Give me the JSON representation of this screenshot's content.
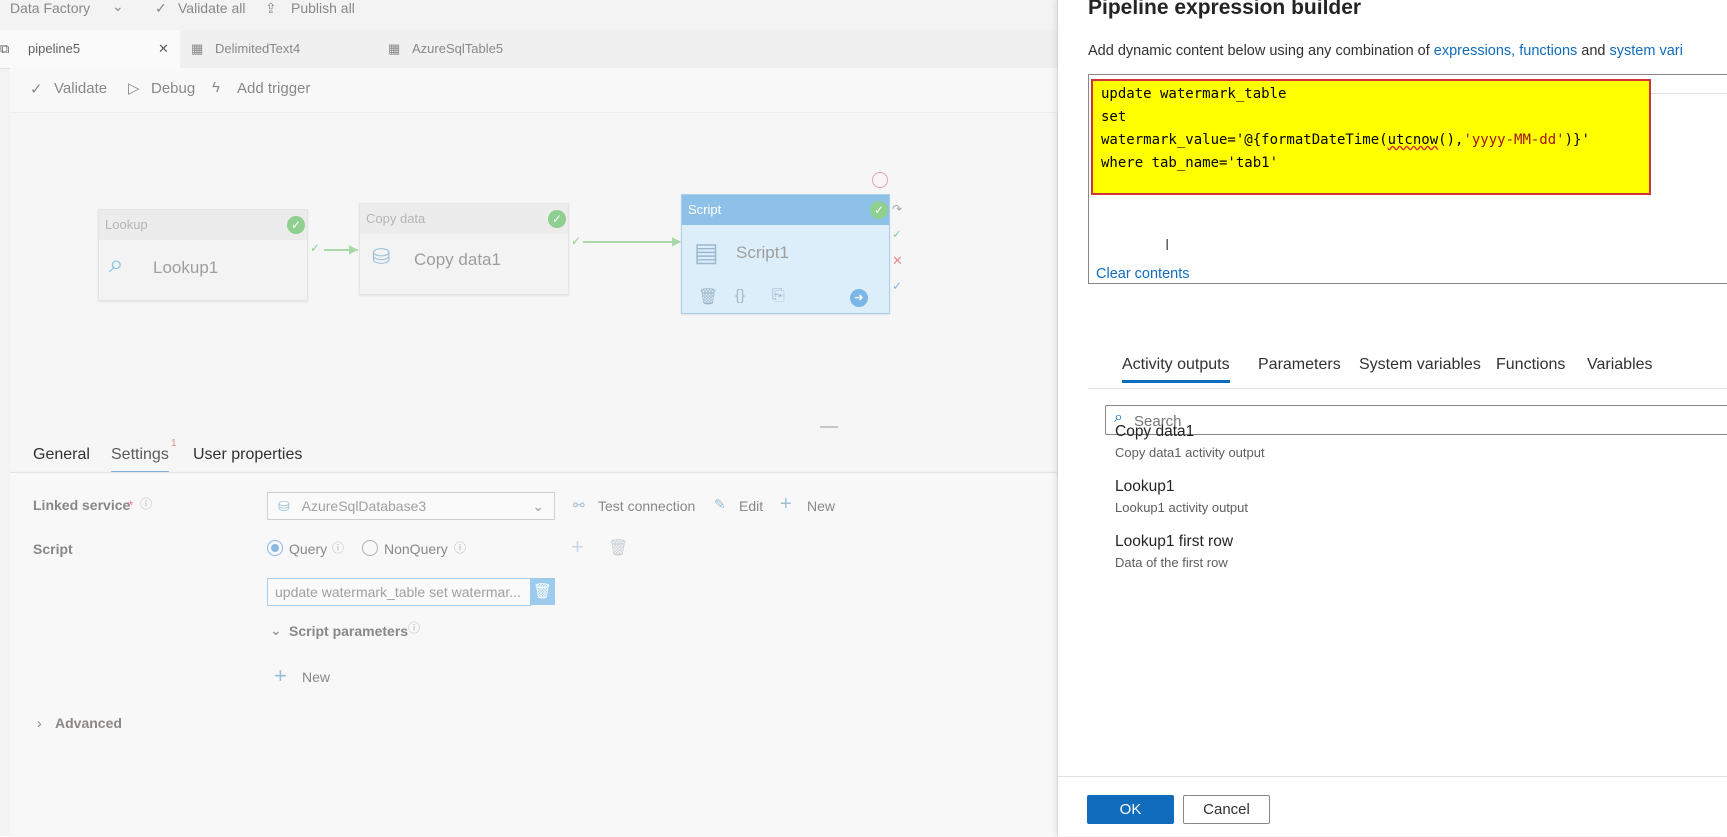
{
  "topbar": {
    "app": "Data Factory",
    "validate_all": "Validate all",
    "publish_all": "Publish all"
  },
  "tabs": [
    {
      "label": "pipeline5",
      "active": true
    },
    {
      "label": "DelimitedText4",
      "active": false
    },
    {
      "label": "AzureSqlTable5",
      "active": false
    }
  ],
  "toolbar": {
    "validate": "Validate",
    "debug": "Debug",
    "add_trigger": "Add trigger"
  },
  "canvas": {
    "lookup": {
      "type": "Lookup",
      "name": "Lookup1"
    },
    "copy": {
      "type": "Copy data",
      "name": "Copy data1"
    },
    "script": {
      "type": "Script",
      "name": "Script1"
    }
  },
  "settings": {
    "tabs": {
      "general": "General",
      "settings": "Settings",
      "settings_badge": "1",
      "user_properties": "User properties"
    },
    "linked_service_label": "Linked service",
    "linked_service_required": "*",
    "linked_service_value": "AzureSqlDatabase3",
    "test_connection": "Test connection",
    "edit": "Edit",
    "new": "New",
    "script_label": "Script",
    "query": "Query",
    "nonquery": "NonQuery",
    "script_text": "update watermark_table set watermar...",
    "script_parameters": "Script parameters",
    "new2": "New",
    "advanced": "Advanced"
  },
  "panel": {
    "title": "Pipeline expression builder",
    "desc_prefix": "Add dynamic content below using any combination of ",
    "desc_link1": "expressions, functions",
    "desc_and": " and ",
    "desc_link2": "system vari",
    "code": {
      "line1": "update watermark_table",
      "line2": "set",
      "line3a": "watermark_value='@{formatDateTime(",
      "line3b": "utcnow",
      "line3c": "(),",
      "line3d": "'yyyy-MM-dd'",
      "line3e": ")}'",
      "line4": "where tab_name='tab1'"
    },
    "clear": "Clear contents",
    "tabs": [
      "Activity outputs",
      "Parameters",
      "System variables",
      "Functions",
      "Variables"
    ],
    "search_placeholder": "Search",
    "items": [
      {
        "title": "Copy data1",
        "sub": "Copy data1 activity output"
      },
      {
        "title": "Lookup1",
        "sub": "Lookup1 activity output"
      },
      {
        "title": "Lookup1 first row",
        "sub": "Data of the first row"
      }
    ],
    "ok": "OK",
    "cancel": "Cancel"
  },
  "colors": {
    "accent": "#0f6cbd",
    "highlight": "#ffff00",
    "highlight_border": "#d13438",
    "success": "#8fcf8f"
  }
}
